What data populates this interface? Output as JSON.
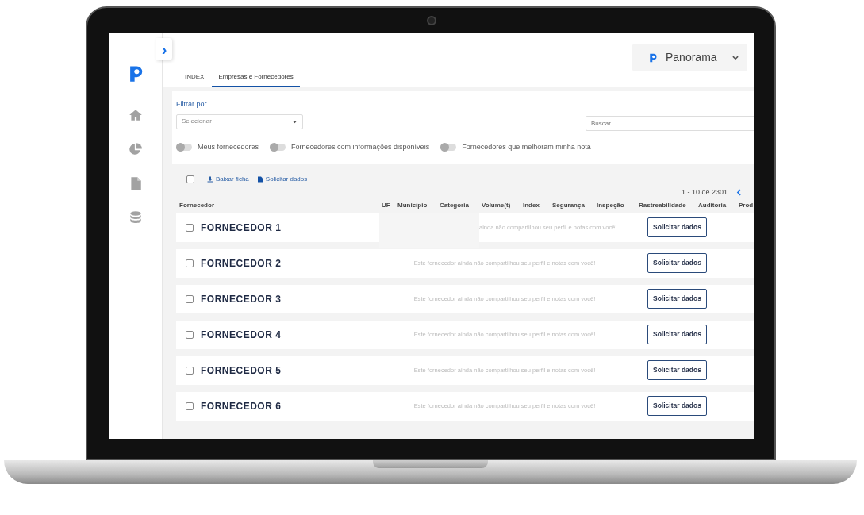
{
  "sidebar": {
    "expand_icon": "›",
    "items": [
      {
        "selected": false
      },
      {
        "selected": false
      },
      {
        "selected": false
      },
      {
        "selected": false
      }
    ]
  },
  "header": {
    "app_menu": {
      "label": "Panorama"
    }
  },
  "tabs": [
    {
      "label": "INDEX",
      "selected": false
    },
    {
      "label": "Empresas e Fornecedores",
      "selected": true
    }
  ],
  "filters": {
    "title": "Filtrar por",
    "select": {
      "placeholder": "Selecionar"
    },
    "search": {
      "placeholder": "Buscar"
    },
    "toggles": [
      {
        "label": "Meus fornecedores",
        "on": false
      },
      {
        "label": "Fornecedores com informações disponíveis",
        "on": false
      },
      {
        "label": "Fornecedores que melhoram minha nota",
        "on": false
      }
    ]
  },
  "toolbar": {
    "select_all": {
      "checked": false
    },
    "actions": [
      {
        "label": "Baixar ficha"
      },
      {
        "label": "Solicitar dados"
      }
    ],
    "pagination": "1 - 10 de 2301"
  },
  "table": {
    "columns": [
      "Fornecedor",
      "UF",
      "Município",
      "Categoria",
      "Volume(t)",
      "Index",
      "Segurança",
      "Inspeção",
      "Rastreabilidade",
      "Auditoria",
      "Prod"
    ],
    "rows": [
      {
        "name": "FORNECEDOR 1",
        "checked": false,
        "message": "ainda não compartilhou seu perfil e notas com você!",
        "covered": true,
        "action": "Solicitar dados"
      },
      {
        "name": "FORNECEDOR 2",
        "checked": false,
        "message": "Este fornecedor ainda não compartilhou seu perfil e notas com você!",
        "covered": false,
        "action": "Solicitar dados"
      },
      {
        "name": "FORNECEDOR 3",
        "checked": false,
        "message": "Este fornecedor ainda não compartilhou seu perfil e notas com você!",
        "covered": false,
        "action": "Solicitar dados"
      },
      {
        "name": "FORNECEDOR 4",
        "checked": false,
        "message": "Este fornecedor ainda não compartilhou seu perfil e notas com você!",
        "covered": false,
        "action": "Solicitar dados"
      },
      {
        "name": "FORNECEDOR 5",
        "checked": false,
        "message": "Este fornecedor ainda não compartilhou seu perfil e notas com você!",
        "covered": false,
        "action": "Solicitar dados"
      },
      {
        "name": "FORNECEDOR 6",
        "checked": false,
        "message": "Este fornecedor ainda não compartilhou seu perfil e notas com você!",
        "covered": false,
        "action": "Solicitar dados"
      }
    ]
  }
}
